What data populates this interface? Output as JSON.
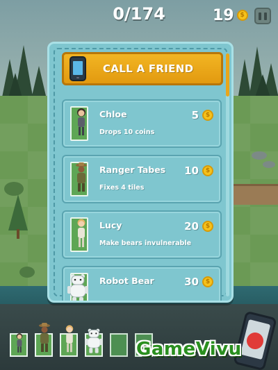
{
  "hud": {
    "progress": "0/174",
    "coins": "19",
    "coin_icon": "coin-icon",
    "pause_icon": "pause-icon"
  },
  "panel": {
    "call_friend_label": "CALL A FRIEND",
    "call_friend_icon": "phone-icon",
    "friends": [
      {
        "name": "Chloe",
        "description": "Drops 10 coins",
        "price": "5"
      },
      {
        "name": "Ranger Tabes",
        "description": "Fixes 4 tiles",
        "price": "10"
      },
      {
        "name": "Lucy",
        "description": "Make bears invulnerable",
        "price": "20"
      },
      {
        "name": "Robot Bear",
        "description": "",
        "price": "30"
      }
    ]
  },
  "bottom": {
    "slots": [
      "Chloe",
      "Ranger Tabes",
      "Lucy",
      "Robot Bear",
      "",
      ""
    ],
    "hangup_icon": "hang-up-phone-icon"
  },
  "watermark": "GameVivu",
  "colors": {
    "panel": "#7fc6cf",
    "button": "#f2b523",
    "coin": "#f6c21b",
    "watermark": "#2a8f1f"
  }
}
